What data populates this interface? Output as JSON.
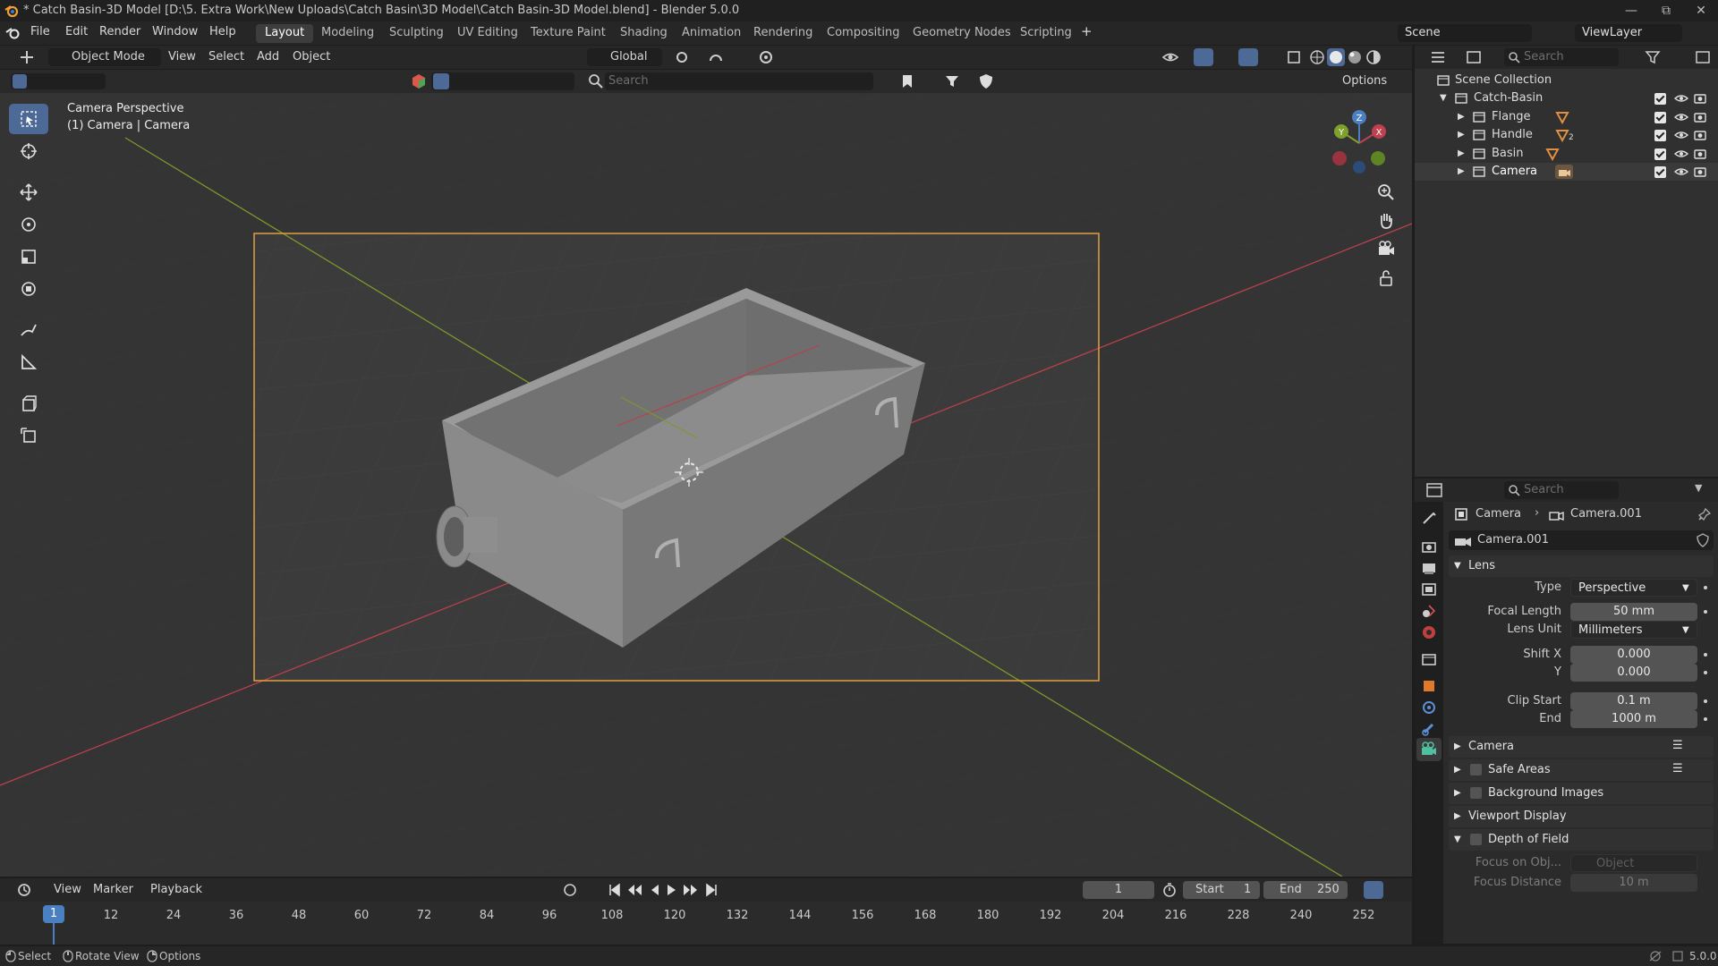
{
  "titlebar": {
    "title": "* Catch Basin-3D Model [D:\\5. Extra Work\\New Uploads\\Catch Basin\\3D Model\\Catch Basin-3D Model.blend] - Blender 5.0.0"
  },
  "menu": {
    "items": [
      "File",
      "Edit",
      "Render",
      "Window",
      "Help"
    ]
  },
  "workspaces": {
    "tabs": [
      "Layout",
      "Modeling",
      "Sculpting",
      "UV Editing",
      "Texture Paint",
      "Shading",
      "Animation",
      "Rendering",
      "Compositing",
      "Geometry Nodes",
      "Scripting"
    ],
    "active": "Layout",
    "add_symbol": "+"
  },
  "scene": {
    "name": "Scene",
    "view_layer": "ViewLayer"
  },
  "viewport_header": {
    "mode": "Object Mode",
    "menus": [
      "View",
      "Select",
      "Add",
      "Object"
    ],
    "orientation": "Global",
    "search_placeholder": "Search",
    "options_label": "Options"
  },
  "viewport": {
    "info_line1": "Camera Perspective",
    "info_line2": "(1) Camera | Camera",
    "gizmo": {
      "x": "X",
      "y": "Y",
      "z": "Z"
    }
  },
  "outliner": {
    "search_placeholder": "Search",
    "root": "Scene Collection",
    "collection": "Catch-Basin",
    "items": [
      {
        "name": "Flange",
        "icon": "mesh-icon",
        "badge": ""
      },
      {
        "name": "Handle",
        "icon": "mesh-icon",
        "badge": "2"
      },
      {
        "name": "Basin",
        "icon": "mesh-icon",
        "badge": ""
      },
      {
        "name": "Camera",
        "icon": "camera-data-icon",
        "badge": ""
      }
    ]
  },
  "properties": {
    "search_placeholder": "Search",
    "breadcrumb_object": "Camera",
    "breadcrumb_data": "Camera.001",
    "datablock_name": "Camera.001",
    "lens_panel": "Lens",
    "type_label": "Type",
    "type_value": "Perspective",
    "focal_length_label": "Focal Length",
    "focal_length_value": "50 mm",
    "lens_unit_label": "Lens Unit",
    "lens_unit_value": "Millimeters",
    "shift_x_label": "Shift X",
    "shift_x_value": "0.000",
    "shift_y_label": "Y",
    "shift_y_value": "0.000",
    "clip_start_label": "Clip Start",
    "clip_start_value": "0.1 m",
    "clip_end_label": "End",
    "clip_end_value": "1000 m",
    "panels": [
      "Camera",
      "Safe Areas",
      "Background Images",
      "Viewport Display",
      "Depth of Field"
    ],
    "focus_object_label": "Focus on Obj...",
    "focus_object_placeholder": "Object",
    "focus_distance_label": "Focus Distance",
    "focus_distance_value": "10 m"
  },
  "timeline": {
    "menus": [
      "View",
      "Marker",
      "Playback"
    ],
    "current_frame": "1",
    "start_label": "Start",
    "start_value": "1",
    "end_label": "End",
    "end_value": "250",
    "ruler": [
      "12",
      "24",
      "36",
      "48",
      "60",
      "72",
      "84",
      "96",
      "108",
      "120",
      "132",
      "144",
      "156",
      "168",
      "180",
      "192",
      "204",
      "216",
      "228",
      "240",
      "252"
    ],
    "playhead": "1"
  },
  "statusbar": {
    "select": "Select",
    "rotate": "Rotate View",
    "options": "Options",
    "version": "5.0.0"
  },
  "colors": {
    "accent": "#4d6a96",
    "camera_frame": "#e0a040",
    "axis_x": "#c04050",
    "axis_y": "#7fa02a",
    "playhead": "#4a7fc1"
  }
}
